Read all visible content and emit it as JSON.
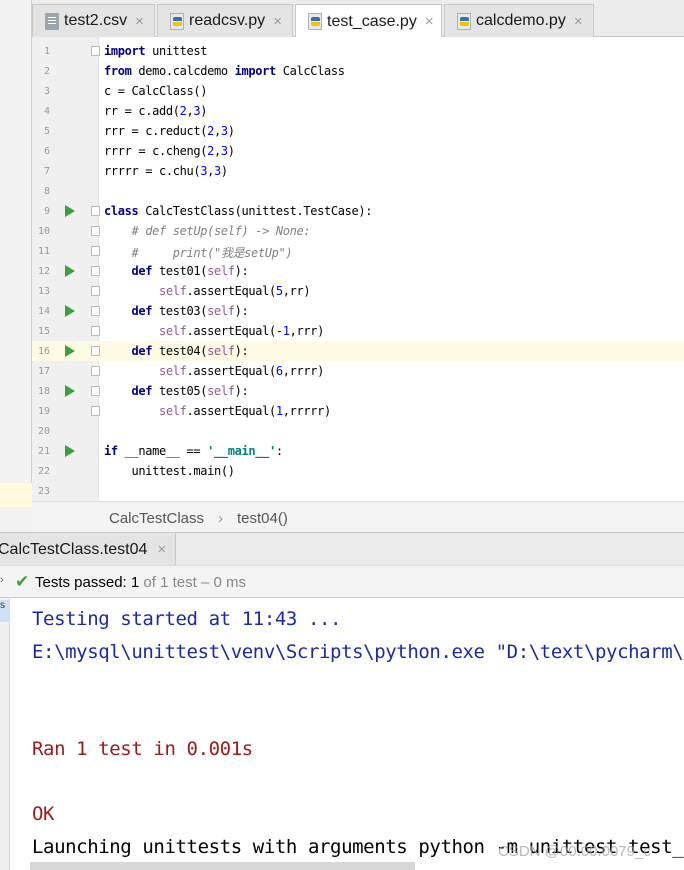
{
  "tabs": [
    {
      "label": "test2.csv",
      "icon": "csv-file-icon",
      "active": false
    },
    {
      "label": "readcsv.py",
      "icon": "python-file-icon",
      "active": false
    },
    {
      "label": "test_case.py",
      "icon": "python-file-icon",
      "active": true
    },
    {
      "label": "calcdemo.py",
      "icon": "python-file-icon",
      "active": false
    }
  ],
  "close_glyph": "×",
  "editor": {
    "line_numbers": [
      "1",
      "2",
      "3",
      "4",
      "5",
      "6",
      "7",
      "8",
      "9",
      "10",
      "11",
      "12",
      "13",
      "14",
      "15",
      "16",
      "17",
      "18",
      "19",
      "20",
      "21",
      "22",
      "23"
    ],
    "lines": [
      {
        "kw": "import",
        "rest": " unittest"
      },
      {
        "kw": "from",
        "rest": " demo.calcdemo ",
        "kw2": "import",
        "rest2": " CalcClass"
      },
      {
        "text": "c = CalcClass()"
      },
      {
        "pre": "rr = c.add(",
        "n1": "2",
        "sep": ",",
        "n2": "3",
        "post": ")"
      },
      {
        "pre": "rrr = c.reduct(",
        "n1": "2",
        "sep": ",",
        "n2": "3",
        "post": ")"
      },
      {
        "pre": "rrrr = c.cheng(",
        "n1": "2",
        "sep": ",",
        "n2": "3",
        "post": ")"
      },
      {
        "pre": "rrrrr = c.chu(",
        "n1": "3",
        "sep": ",",
        "n2": "3",
        "post": ")"
      },
      {
        "text": ""
      },
      {
        "kw": "class",
        "rest": " CalcTestClass(unittest.TestCase):"
      },
      {
        "comment": "    # def setUp(self) -> None:"
      },
      {
        "comment": "    #     print(\"我是setUp\")"
      },
      {
        "indent": "    ",
        "kw": "def",
        "rest": " test01(",
        "self": "self",
        "post": "):"
      },
      {
        "indent": "        ",
        "self": "self",
        "rest": ".assertEqual(",
        "n1": "5",
        "post": ",rr)"
      },
      {
        "indent": "    ",
        "kw": "def",
        "rest": " test03(",
        "self": "self",
        "post": "):"
      },
      {
        "indent": "        ",
        "self": "self",
        "rest": ".assertEqual(",
        "n1": "-1",
        "post": ",rrr)"
      },
      {
        "indent": "    ",
        "kw": "def",
        "rest": " test04(",
        "self": "self",
        "post": "):"
      },
      {
        "indent": "        ",
        "self": "self",
        "rest": ".assertEqual(",
        "n1": "6",
        "post": ",rrrr)"
      },
      {
        "indent": "    ",
        "kw": "def",
        "rest": " test05(",
        "self": "self",
        "post": "):"
      },
      {
        "indent": "        ",
        "self": "self",
        "rest": ".assertEqual(",
        "n1": "1",
        "post": ",rrrrr)"
      },
      {
        "text": ""
      },
      {
        "kw": "if",
        "rest": " __name__ == ",
        "str": "'__main__'",
        "post": ":"
      },
      {
        "text": "    unittest.main()"
      },
      {
        "text": ""
      }
    ],
    "run_marker_lines": [
      9,
      12,
      14,
      16,
      18,
      21
    ],
    "highlighted_line": 16
  },
  "breadcrumb": {
    "class": "CalcTestClass",
    "sep": "›",
    "method": "test04()"
  },
  "run_tab": {
    "label": "CalcTestClass.test04"
  },
  "status": {
    "chevron": "›",
    "check": "✔",
    "prefix": "Tests passed: ",
    "passed": "1",
    "suffix": " of 1 test – 0 ms"
  },
  "console": {
    "strip_label": "s",
    "lines": [
      {
        "text": "Testing started at 11:43 ...",
        "color": "blue"
      },
      {
        "text": "E:\\mysql\\unittest\\venv\\Scripts\\python.exe \"D:\\text\\pycharm\\l",
        "color": "blue"
      },
      {
        "text": "Ran 1 test in 0.001s",
        "color": "red"
      },
      {
        "text": "OK",
        "color": "red"
      },
      {
        "text": "Launching unittests with arguments python -m unittest test_c",
        "color": "black"
      }
    ]
  },
  "watermark": "CSDN @00:00:0079_c",
  "colors": {
    "run_green": "#3c9f3c",
    "keyword": "#000080",
    "number": "#0000ff",
    "self": "#94558d",
    "string": "#008080",
    "console_blue": "#1a2aa6",
    "console_red": "#9b1a1a"
  }
}
